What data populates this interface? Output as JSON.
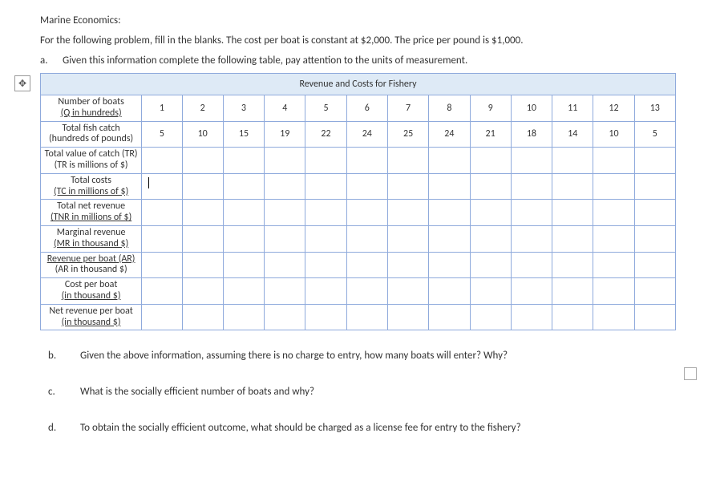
{
  "title": "Marine Economics:",
  "intro": "For the following problem, fill in the blanks. The cost per boat is constant at $2,000. The price per pound is $1,000.",
  "sub_a_letter": "a.",
  "sub_a_text": "Given this information complete the following table, pay attention to the units of measurement.",
  "table_header": "Revenue and Costs for Fishery",
  "rows": {
    "r0": {
      "label_l1": "Number of boats",
      "label_l2": "(Q in hundreds)",
      "c": [
        "1",
        "2",
        "3",
        "4",
        "5",
        "6",
        "7",
        "8",
        "9",
        "10",
        "11",
        "12",
        "13"
      ]
    },
    "r1": {
      "label_l1": "Total fish catch",
      "label_l2": "(hundreds of pounds)",
      "c": [
        "5",
        "10",
        "15",
        "19",
        "22",
        "24",
        "25",
        "24",
        "21",
        "18",
        "14",
        "10",
        "5"
      ]
    },
    "r2": {
      "label_l1": "Total value of catch (TR)",
      "label_l2": "(TR is millions of $)",
      "c": [
        "",
        "",
        "",
        "",
        "",
        "",
        "",
        "",
        "",
        "",
        "",
        "",
        ""
      ]
    },
    "r3": {
      "label_l1": "Total costs",
      "label_l2": "(TC in millions of $)",
      "c": [
        "",
        "",
        "",
        "",
        "",
        "",
        "",
        "",
        "",
        "",
        "",
        "",
        ""
      ]
    },
    "r4": {
      "label_l1": "Total net revenue",
      "label_l2": "(TNR in millions of $)",
      "c": [
        "",
        "",
        "",
        "",
        "",
        "",
        "",
        "",
        "",
        "",
        "",
        "",
        ""
      ]
    },
    "r5": {
      "label_l1": "Marginal revenue",
      "label_l2": "(MR in thousand $)",
      "c": [
        "",
        "",
        "",
        "",
        "",
        "",
        "",
        "",
        "",
        "",
        "",
        "",
        ""
      ]
    },
    "r6": {
      "label_l1": "Revenue per boat (AR)",
      "label_l2": "(AR in thousand $)",
      "c": [
        "",
        "",
        "",
        "",
        "",
        "",
        "",
        "",
        "",
        "",
        "",
        "",
        ""
      ]
    },
    "r7": {
      "label_l1": "Cost per boat",
      "label_l2": "(in thousand $)",
      "c": [
        "",
        "",
        "",
        "",
        "",
        "",
        "",
        "",
        "",
        "",
        "",
        "",
        ""
      ]
    },
    "r8": {
      "label_l1": "Net revenue per boat",
      "label_l2": "(in thousand $)",
      "c": [
        "",
        "",
        "",
        "",
        "",
        "",
        "",
        "",
        "",
        "",
        "",
        "",
        ""
      ]
    }
  },
  "q_b_letter": "b.",
  "q_b_text": "Given the above information, assuming there is no charge to entry, how many boats will enter? Why?",
  "q_c_letter": "c.",
  "q_c_text": "What is the socially efficient number of boats and why?",
  "q_d_letter": "d.",
  "q_d_text": "To obtain the socially efficient outcome, what should be charged as a license fee for entry to the fishery?",
  "move_glyph": "✥"
}
